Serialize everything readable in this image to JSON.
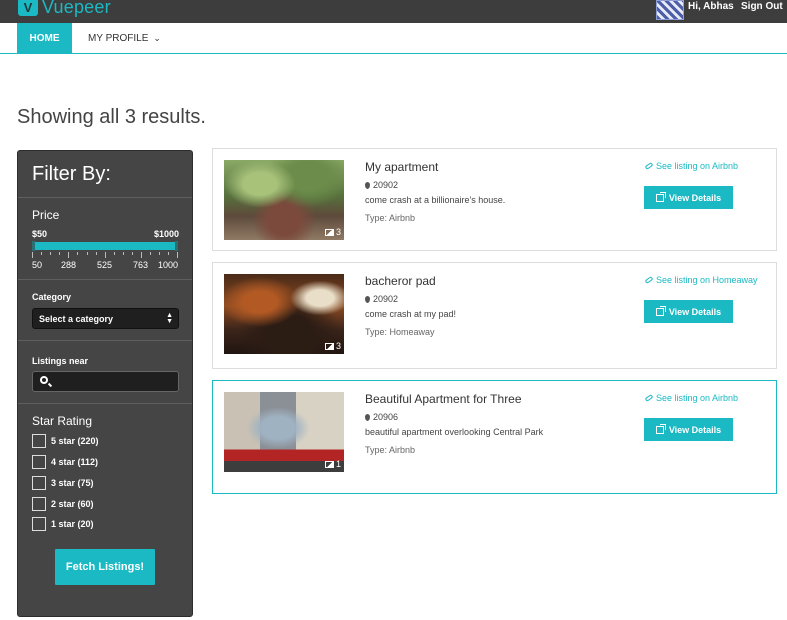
{
  "app": {
    "brand_letter": "V",
    "brand_name": "Vuepeer"
  },
  "header": {
    "greeting": "Hi, Abhas",
    "signout_label": "Sign Out"
  },
  "nav": {
    "home_label": "HOME",
    "profile_label": "MY PROFILE"
  },
  "results": {
    "heading": "Showing all 3 results."
  },
  "filter": {
    "title": "Filter By:",
    "price": {
      "label": "Price",
      "min_label": "$50",
      "max_label": "$1000",
      "range_selected": [
        50,
        1000
      ],
      "ticks": [
        "50",
        "288",
        "525",
        "763",
        "1000"
      ]
    },
    "category": {
      "label": "Category",
      "selected": "Select a category"
    },
    "near": {
      "label": "Listings near",
      "value": ""
    },
    "stars": {
      "label": "Star Rating",
      "options": [
        {
          "label": "5 star (220)",
          "checked": false
        },
        {
          "label": "4 star (112)",
          "checked": false
        },
        {
          "label": "3 star (75)",
          "checked": false
        },
        {
          "label": "2 star (60)",
          "checked": false
        },
        {
          "label": "1 star (20)",
          "checked": false
        }
      ]
    },
    "fetch_label": "Fetch Listings!"
  },
  "listings": [
    {
      "title": "My apartment",
      "zip": "20902",
      "description": "come crash at a billionaire's house.",
      "type": "Type: Airbnb",
      "external_link": "See listing on Airbnb",
      "details_label": "View Details",
      "photo_count": "3"
    },
    {
      "title": "bacheror pad",
      "zip": "20902",
      "description": "come crash at my pad!",
      "type": "Type: Homeaway",
      "external_link": "See listing on Homeaway",
      "details_label": "View Details",
      "photo_count": "3"
    },
    {
      "title": "Beautiful Apartment for Three",
      "zip": "20906",
      "description": "beautiful apartment overlooking Central Park",
      "type": "Type: Airbnb",
      "external_link": "See listing on Airbnb",
      "details_label": "View Details",
      "photo_count": "1"
    }
  ],
  "colors": {
    "accent": "#1bb9c3",
    "topbar": "#3d3d3d",
    "sidebar": "#454545"
  }
}
